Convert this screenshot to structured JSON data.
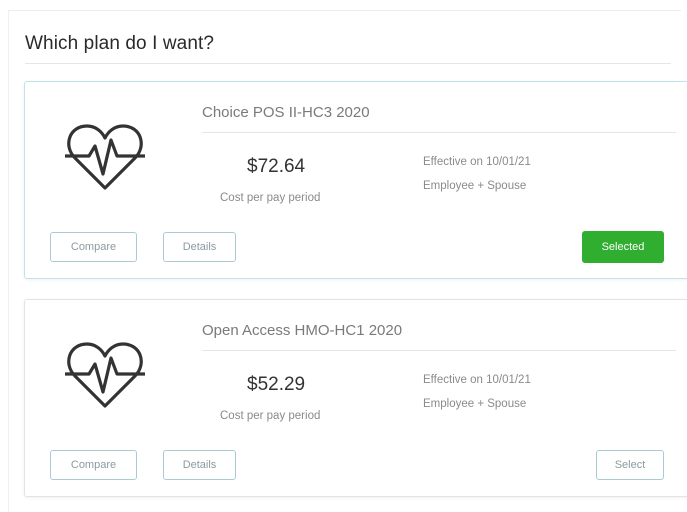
{
  "page": {
    "title": "Which plan do I want?"
  },
  "plans": [
    {
      "name": "Choice POS II-HC3 2020",
      "price": "$72.64",
      "price_label": "Cost per pay period",
      "effective": "Effective on 10/01/21",
      "coverage": "Employee + Spouse",
      "compare_label": "Compare",
      "details_label": "Details",
      "action_label": "Selected",
      "state": "selected"
    },
    {
      "name": "Open Access HMO-HC1 2020",
      "price": "$52.29",
      "price_label": "Cost per pay period",
      "effective": "Effective on 10/01/21",
      "coverage": "Employee + Spouse",
      "compare_label": "Compare",
      "details_label": "Details",
      "action_label": "Select",
      "state": "unselected"
    }
  ],
  "icons": {
    "plan_icon": "heart-pulse-icon"
  },
  "colors": {
    "selected_button": "#2fae2f",
    "selected_card_border": "#bfe3ea",
    "outline_button_border": "#aacbd6"
  }
}
